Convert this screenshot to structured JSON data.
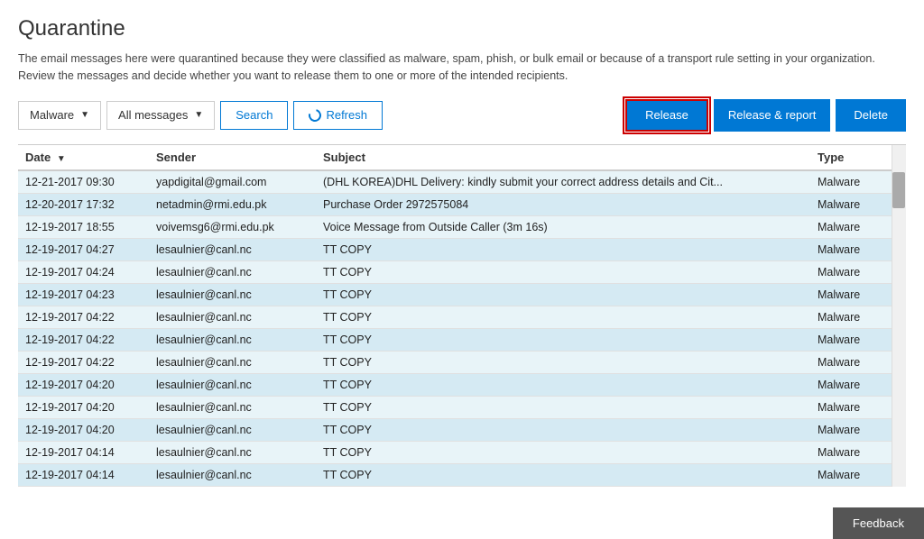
{
  "page": {
    "title": "Quarantine",
    "description": "The email messages here were quarantined because they were classified as malware, spam, phish, or bulk email or because of a transport rule setting in your organization. Review the messages and decide whether you want to release them to one or more of the intended recipients."
  },
  "toolbar": {
    "filter1_label": "Malware",
    "filter2_label": "All messages",
    "search_label": "Search",
    "refresh_label": "Refresh",
    "release_label": "Release",
    "release_report_label": "Release & report",
    "delete_label": "Delete"
  },
  "table": {
    "headers": {
      "date": "Date",
      "sender": "Sender",
      "subject": "Subject",
      "type": "Type"
    },
    "rows": [
      {
        "date": "12-21-2017 09:30",
        "sender": "yapdigital@gmail.com",
        "subject": "(DHL KOREA)DHL Delivery: kindly submit your correct address details and Cit...",
        "type": "Malware"
      },
      {
        "date": "12-20-2017 17:32",
        "sender": "netadmin@rmi.edu.pk",
        "subject": "Purchase Order 2972575084",
        "type": "Malware"
      },
      {
        "date": "12-19-2017 18:55",
        "sender": "voivemsg6@rmi.edu.pk",
        "subject": "Voice Message from Outside Caller (3m 16s)",
        "type": "Malware"
      },
      {
        "date": "12-19-2017 04:27",
        "sender": "lesaulnier@canl.nc",
        "subject": "TT COPY",
        "type": "Malware"
      },
      {
        "date": "12-19-2017 04:24",
        "sender": "lesaulnier@canl.nc",
        "subject": "TT COPY",
        "type": "Malware"
      },
      {
        "date": "12-19-2017 04:23",
        "sender": "lesaulnier@canl.nc",
        "subject": "TT COPY",
        "type": "Malware"
      },
      {
        "date": "12-19-2017 04:22",
        "sender": "lesaulnier@canl.nc",
        "subject": "TT COPY",
        "type": "Malware"
      },
      {
        "date": "12-19-2017 04:22",
        "sender": "lesaulnier@canl.nc",
        "subject": "TT COPY",
        "type": "Malware"
      },
      {
        "date": "12-19-2017 04:22",
        "sender": "lesaulnier@canl.nc",
        "subject": "TT COPY",
        "type": "Malware"
      },
      {
        "date": "12-19-2017 04:20",
        "sender": "lesaulnier@canl.nc",
        "subject": "TT COPY",
        "type": "Malware"
      },
      {
        "date": "12-19-2017 04:20",
        "sender": "lesaulnier@canl.nc",
        "subject": "TT COPY",
        "type": "Malware"
      },
      {
        "date": "12-19-2017 04:20",
        "sender": "lesaulnier@canl.nc",
        "subject": "TT COPY",
        "type": "Malware"
      },
      {
        "date": "12-19-2017 04:14",
        "sender": "lesaulnier@canl.nc",
        "subject": "TT COPY",
        "type": "Malware"
      },
      {
        "date": "12-19-2017 04:14",
        "sender": "lesaulnier@canl.nc",
        "subject": "TT COPY",
        "type": "Malware"
      }
    ]
  },
  "feedback": {
    "label": "Feedback"
  }
}
